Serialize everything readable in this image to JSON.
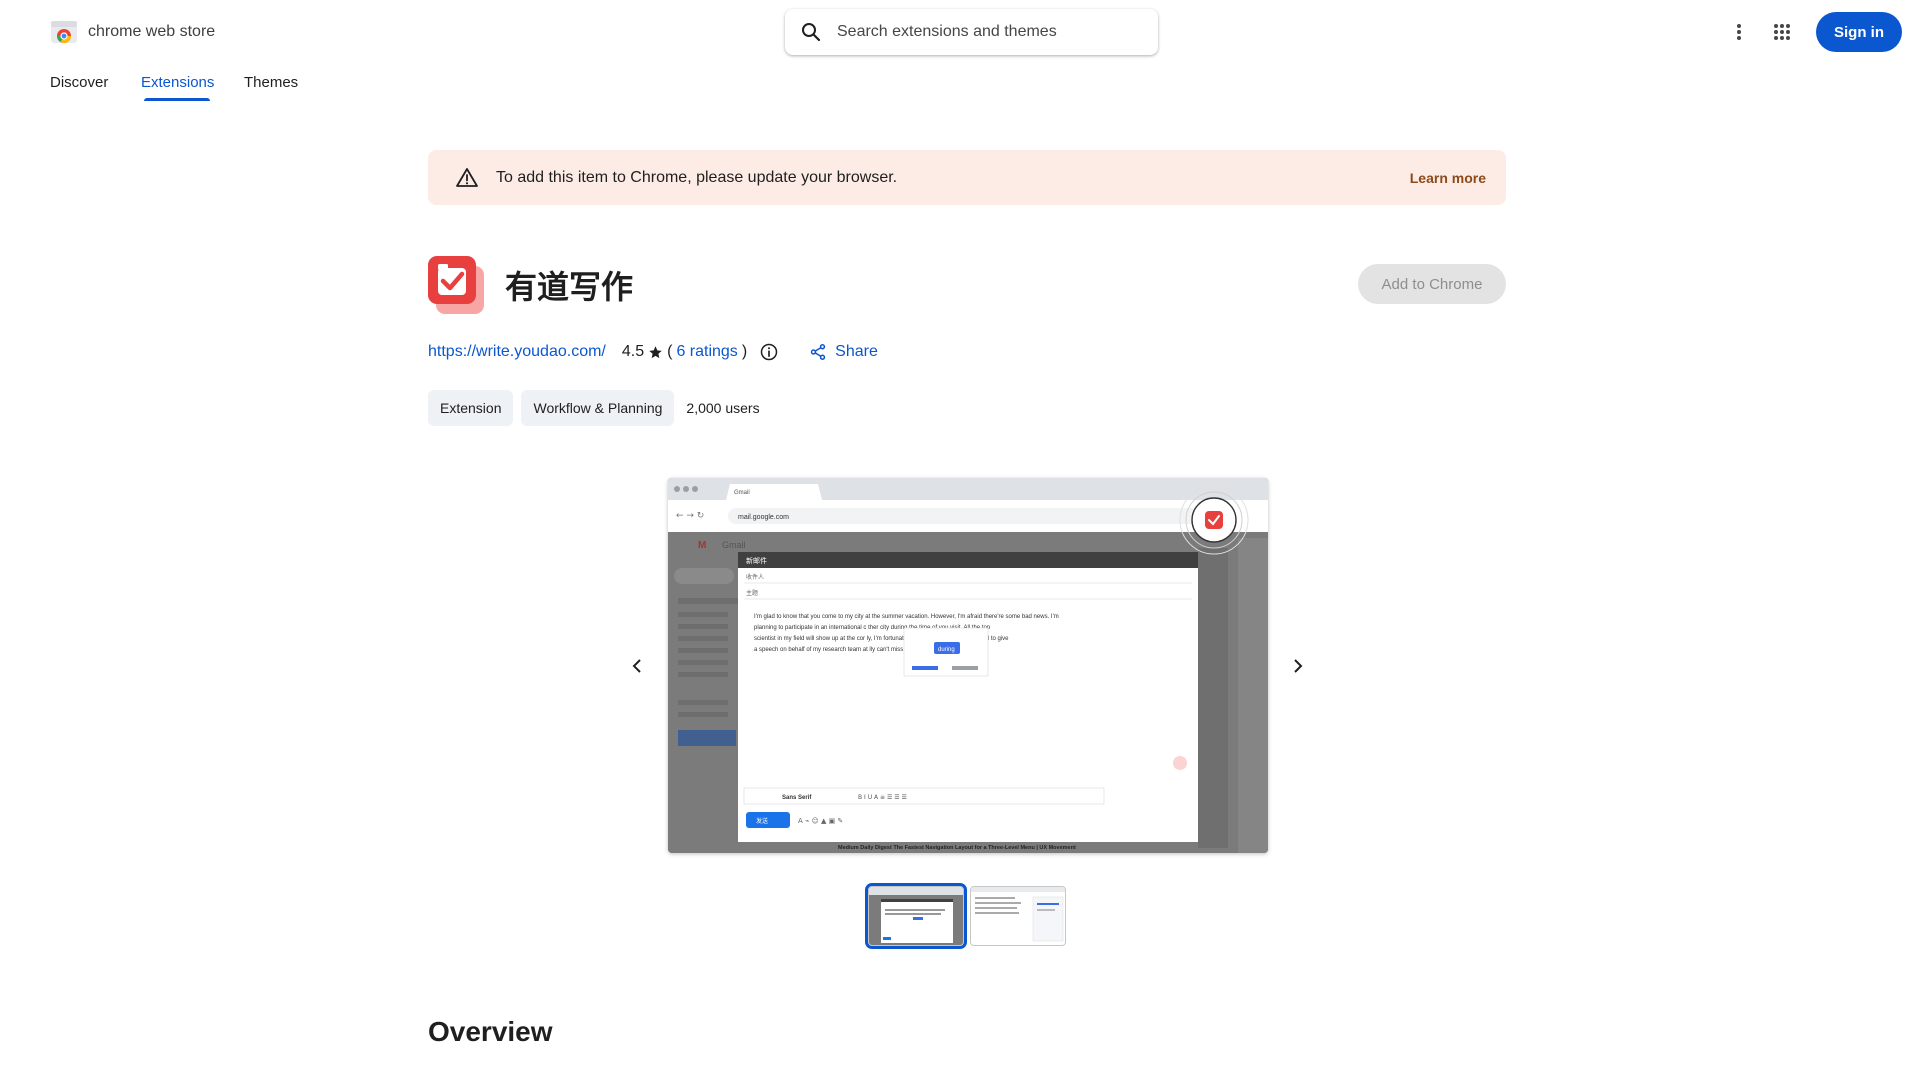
{
  "header": {
    "brand": "chrome web store",
    "search_placeholder": "Search extensions and themes",
    "signin_label": "Sign in"
  },
  "nav": {
    "items": [
      {
        "label": "Discover"
      },
      {
        "label": "Extensions"
      },
      {
        "label": "Themes"
      }
    ],
    "active": "Extensions"
  },
  "banner": {
    "text": "To add this item to Chrome, please update your browser.",
    "link": "Learn more"
  },
  "extension": {
    "title": "有道写作",
    "add_label": "Add to Chrome",
    "url": "https://write.youdao.com/",
    "rating": "4.5",
    "ratings_paren_open": "(",
    "ratings_link": "6 ratings",
    "ratings_paren_close": ")",
    "share_label": "Share",
    "chips": [
      "Extension",
      "Workflow & Planning"
    ],
    "users": "2,000 users"
  },
  "screenshot": {
    "tab_label": "Gmail",
    "address": "mail.google.com",
    "compose_title": "新邮件",
    "to_label": "收件人",
    "subject_label": "主题",
    "body_lines": [
      "I'm glad to know that you come to my city at the summer vacation. However, I'm afraid there're some bad news. I'm",
      "planning to participate in an international c          ther city during the time of you visit. All the top",
      "scientist in my field will show up at the cor          ly, I'm fortunate enough to have been selected to give",
      "a speech on behalf of my research team at           lly can't miss it."
    ],
    "suggestion": "during",
    "send_label": "发送",
    "font_label": "Sans Serif",
    "footer_text": "Medium Daily Digest    The Fastest Navigation Layout for a Three-Level Menu | UX Movement"
  },
  "overview": {
    "heading": "Overview"
  },
  "colors": {
    "primary": "#0b57d0",
    "banner_bg": "#fdece6",
    "learn_more": "#8c4a1b",
    "icon_red": "#e8403f"
  }
}
